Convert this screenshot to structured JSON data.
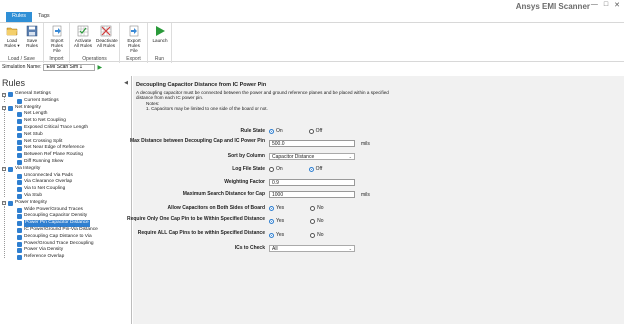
{
  "app": {
    "title": "Ansys EMI Scanner",
    "window_controls": [
      "—",
      "□",
      "✕"
    ]
  },
  "tabs": [
    {
      "label": "Rules",
      "active": true
    },
    {
      "label": "Tags",
      "active": false
    }
  ],
  "ribbon": {
    "groups": [
      {
        "label": "Load / Save",
        "buttons": [
          {
            "label": "Load\nRules ▾",
            "icon": "folder-open-icon"
          },
          {
            "label": "Save\nRules",
            "icon": "save-icon"
          }
        ]
      },
      {
        "label": "Import",
        "buttons": [
          {
            "label": "Import\nRules File",
            "icon": "import-icon"
          }
        ]
      },
      {
        "label": "Operations",
        "buttons": [
          {
            "label": "Activate\nAll Rules",
            "icon": "activate-grid-icon"
          },
          {
            "label": "Deactivate\nAll Rules",
            "icon": "deactivate-grid-icon"
          }
        ]
      },
      {
        "label": "Export",
        "buttons": [
          {
            "label": "Export\nRules File",
            "icon": "export-icon"
          }
        ]
      },
      {
        "label": "Run",
        "buttons": [
          {
            "label": "Launch",
            "icon": "play-icon"
          }
        ]
      }
    ]
  },
  "simulation": {
    "label": "Simulation Name:",
    "value": "EMI Scan Sim 1"
  },
  "sidebar": {
    "title": "Rules",
    "items": [
      {
        "label": "General Settings",
        "level": 0,
        "selected": false
      },
      {
        "label": "Current Settings",
        "level": 1,
        "selected": false
      },
      {
        "label": "Net Integrity",
        "level": 0,
        "selected": false
      },
      {
        "label": "Net Length",
        "level": 1,
        "selected": false
      },
      {
        "label": "Net to Net Coupling",
        "level": 1,
        "selected": false
      },
      {
        "label": "Exposed Critical Trace Length",
        "level": 1,
        "selected": false
      },
      {
        "label": "Net Stub",
        "level": 1,
        "selected": false
      },
      {
        "label": "Net Crossing Split",
        "level": 1,
        "selected": false
      },
      {
        "label": "Net Near Edge of Reference",
        "level": 1,
        "selected": false
      },
      {
        "label": "Between Ref Plane Routing",
        "level": 1,
        "selected": false
      },
      {
        "label": "Diff Running Skew",
        "level": 1,
        "selected": false
      },
      {
        "label": "Via Integrity",
        "level": 0,
        "selected": false
      },
      {
        "label": "Unconnected Via Pads",
        "level": 1,
        "selected": false
      },
      {
        "label": "Via Clearance Overlap",
        "level": 1,
        "selected": false
      },
      {
        "label": "Via to Net Coupling",
        "level": 1,
        "selected": false
      },
      {
        "label": "Via Stub",
        "level": 1,
        "selected": false
      },
      {
        "label": "Power Integrity",
        "level": 0,
        "selected": false
      },
      {
        "label": "Wide Power/Ground Traces",
        "level": 1,
        "selected": false
      },
      {
        "label": "Decoupling Capacitor Density",
        "level": 1,
        "selected": false
      },
      {
        "label": "Power Pin Capacitor Distance",
        "level": 1,
        "selected": true
      },
      {
        "label": "IC Power/Ground Pin-Via Distance",
        "level": 1,
        "selected": false
      },
      {
        "label": "Decoupling Cap Distance to Via",
        "level": 1,
        "selected": false
      },
      {
        "label": "Power/Ground Trace Decoupling",
        "level": 1,
        "selected": false
      },
      {
        "label": "Power Via Density",
        "level": 1,
        "selected": false
      },
      {
        "label": "Reference Overlap",
        "level": 1,
        "selected": false
      }
    ]
  },
  "panel": {
    "title": "Decoupling Capacitor Distance from IC Power Pin",
    "description": "A decoupling capacitor must be connected between the power and ground reference planes and be placed within a specified distance from each IC power pin.",
    "notes_label": "Notes:",
    "note_1": "1. Capacitors may be limited to one side of the board or not.",
    "fields": {
      "rule_state": {
        "label": "Rule State",
        "on": "On",
        "off": "Off",
        "value": "On"
      },
      "max_distance": {
        "label": "Max Distance between Decoupling Cap and IC Power Pin",
        "value": "500.0",
        "unit": "mils"
      },
      "sort_by": {
        "label": "Sort by Column",
        "value": "Capacitor Distance"
      },
      "log_file_state": {
        "label": "Log File State",
        "on": "On",
        "off": "Off",
        "value": "Off"
      },
      "weighting_factor": {
        "label": "Weighting Factor",
        "value": "0.9"
      },
      "max_search_distance": {
        "label": "Maximum Search Distance for Cap",
        "value": "1000",
        "unit": "mils"
      },
      "allow_both_sides": {
        "label": "Allow Capacitors on Both Sides of Board",
        "yes": "Yes",
        "no": "No",
        "value": "Yes"
      },
      "only_one_cap_pin": {
        "label": "Require Only One Cap Pin to be Within Specified Distance",
        "yes": "Yes",
        "no": "No",
        "value": "Yes"
      },
      "all_cap_pins": {
        "label": "Require ALL Cap Pins to be within Specified Distance",
        "yes": "Yes",
        "no": "No",
        "value": "Yes"
      },
      "ics_to_check": {
        "label": "ICs to Check",
        "value": "All"
      }
    }
  },
  "colors": {
    "accent": "#2f7fd0",
    "tab_active": "#2f8fd6",
    "panel_bg": "#f1f1f1"
  }
}
